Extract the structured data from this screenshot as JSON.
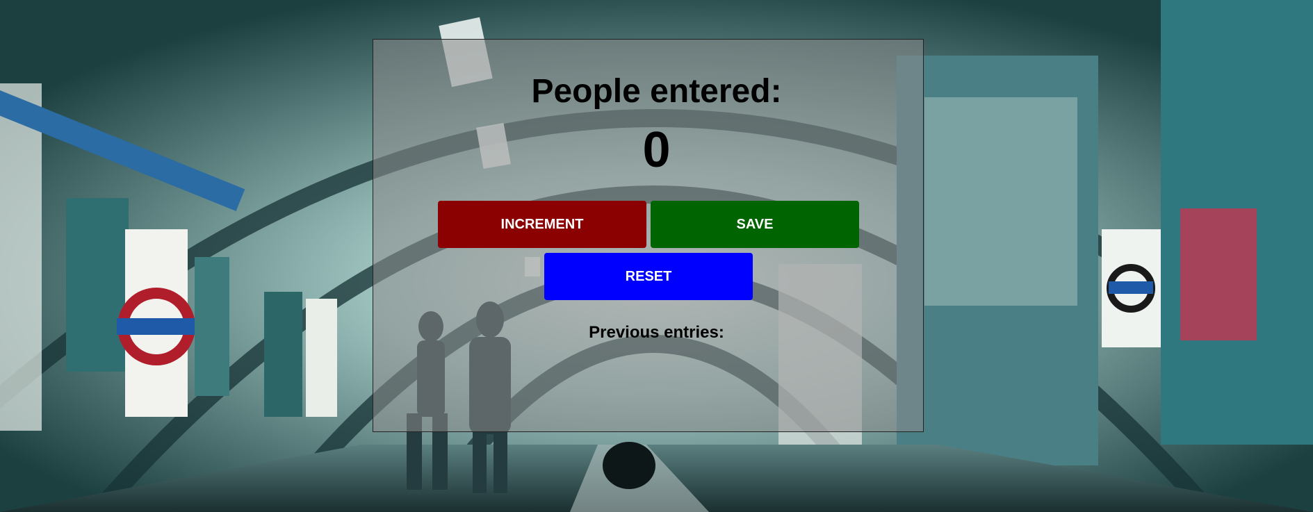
{
  "counter": {
    "heading": "People entered:",
    "count": "0",
    "previous_label": "Previous entries:",
    "previous_entries": ""
  },
  "buttons": {
    "increment_label": "INCREMENT",
    "save_label": "SAVE",
    "reset_label": "RESET"
  },
  "colors": {
    "increment": "#8b0000",
    "save": "#006400",
    "reset": "#0000ff",
    "panel_overlay": "rgba(140,140,140,0.55)"
  }
}
